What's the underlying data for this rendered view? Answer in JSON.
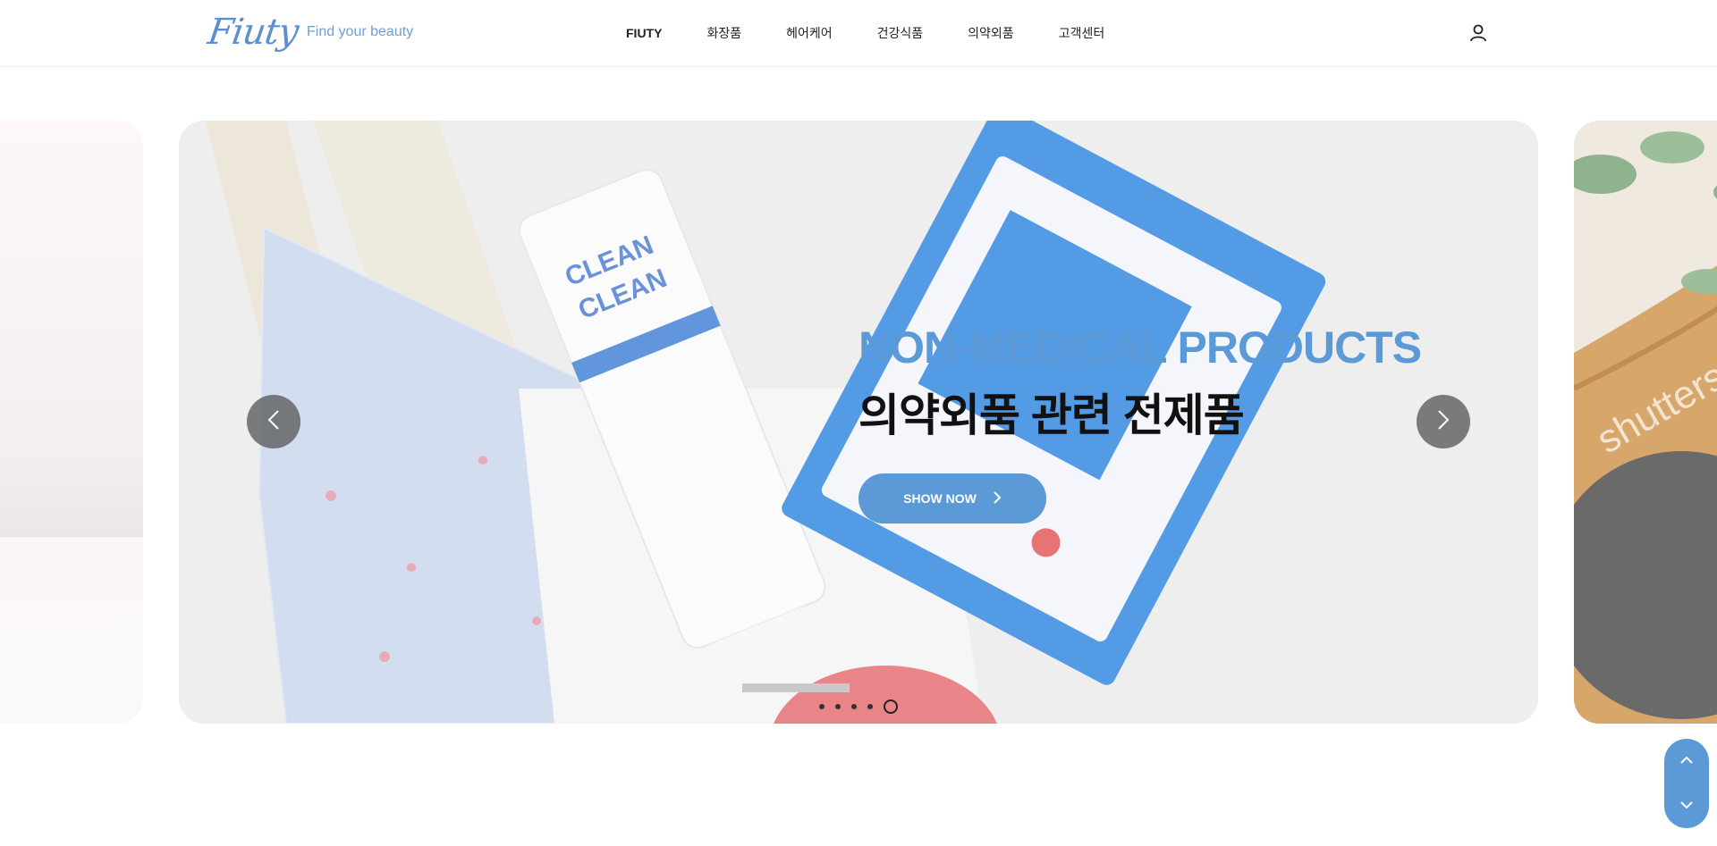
{
  "header": {
    "logo_text": "Fiuty",
    "tagline": "Find your beauty",
    "nav": [
      {
        "label": "FIUTY"
      },
      {
        "label": "화장품"
      },
      {
        "label": "헤어케어"
      },
      {
        "label": "건강식품"
      },
      {
        "label": "의약외품"
      },
      {
        "label": "고객센터"
      }
    ],
    "user_icon": "user-icon"
  },
  "hero": {
    "title_en": "NON-MEDICAL PRODUCTS",
    "title_ko": "의약외품 관련 전제품",
    "cta_label": "SHOW NOW",
    "prev_icon": "chevron-left-icon",
    "next_icon": "chevron-right-icon",
    "slide_count": 5,
    "active_slide": 5
  },
  "scroll": {
    "up_icon": "chevron-up-icon",
    "down_icon": "chevron-down-icon"
  },
  "colors": {
    "accent": "#5b9ad6",
    "text": "#111111",
    "logo": "#5b8fcf"
  }
}
